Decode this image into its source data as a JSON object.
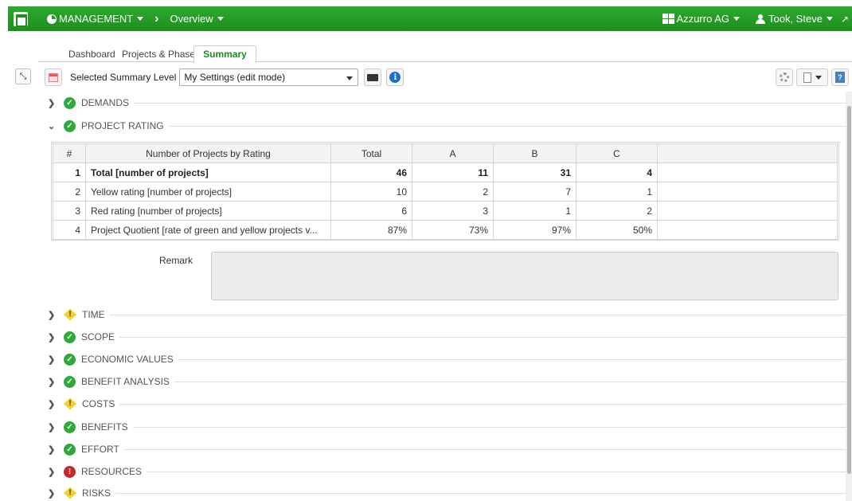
{
  "header": {
    "module": "MANAGEMENT",
    "view": "Overview",
    "company": "Azzurro AG",
    "user": "Took, Steve"
  },
  "tabs": [
    {
      "label": "Dashboard"
    },
    {
      "label": "Projects & Phases"
    },
    {
      "label": "Summary",
      "active": true
    }
  ],
  "toolbar": {
    "level_label": "Selected Summary Level",
    "level_value": "My Settings (edit mode)"
  },
  "sections": {
    "demands": {
      "label": "DEMANDS",
      "status": "ok"
    },
    "project_rating": {
      "label": "PROJECT RATING",
      "status": "ok",
      "expanded": true
    },
    "time": {
      "label": "TIME",
      "status": "warning"
    },
    "scope": {
      "label": "SCOPE",
      "status": "ok"
    },
    "economic_values": {
      "label": "ECONOMIC VALUES",
      "status": "ok"
    },
    "benefit_analysis": {
      "label": "BENEFIT ANALYSIS",
      "status": "ok"
    },
    "costs": {
      "label": "COSTS",
      "status": "warning"
    },
    "benefits": {
      "label": "BENEFITS",
      "status": "ok"
    },
    "effort": {
      "label": "EFFORT",
      "status": "ok"
    },
    "resources": {
      "label": "RESOURCES",
      "status": "error"
    },
    "risks": {
      "label": "RISKS",
      "status": "warning"
    }
  },
  "rating_table": {
    "headers": {
      "idx": "#",
      "name": "Number of Projects by Rating",
      "total": "Total",
      "a": "A",
      "b": "B",
      "c": "C"
    },
    "rows": [
      {
        "idx": "1",
        "name": "Total [number of projects]",
        "total": "46",
        "a": "11",
        "b": "31",
        "c": "4"
      },
      {
        "idx": "2",
        "name": "Yellow rating [number of projects]",
        "total": "10",
        "a": "2",
        "b": "7",
        "c": "1"
      },
      {
        "idx": "3",
        "name": "Red rating [number of projects]",
        "total": "6",
        "a": "3",
        "b": "1",
        "c": "2"
      },
      {
        "idx": "4",
        "name": "Project Quotient [rate of green and yellow projects v...",
        "total": "87%",
        "a": "73%",
        "b": "97%",
        "c": "50%"
      }
    ]
  },
  "remark": {
    "label": "Remark",
    "value": ""
  },
  "colors": {
    "brand_green": "#1d8f1d",
    "ok": "#2eaa3a",
    "warning": "#f2d22a",
    "error": "#c62828"
  }
}
